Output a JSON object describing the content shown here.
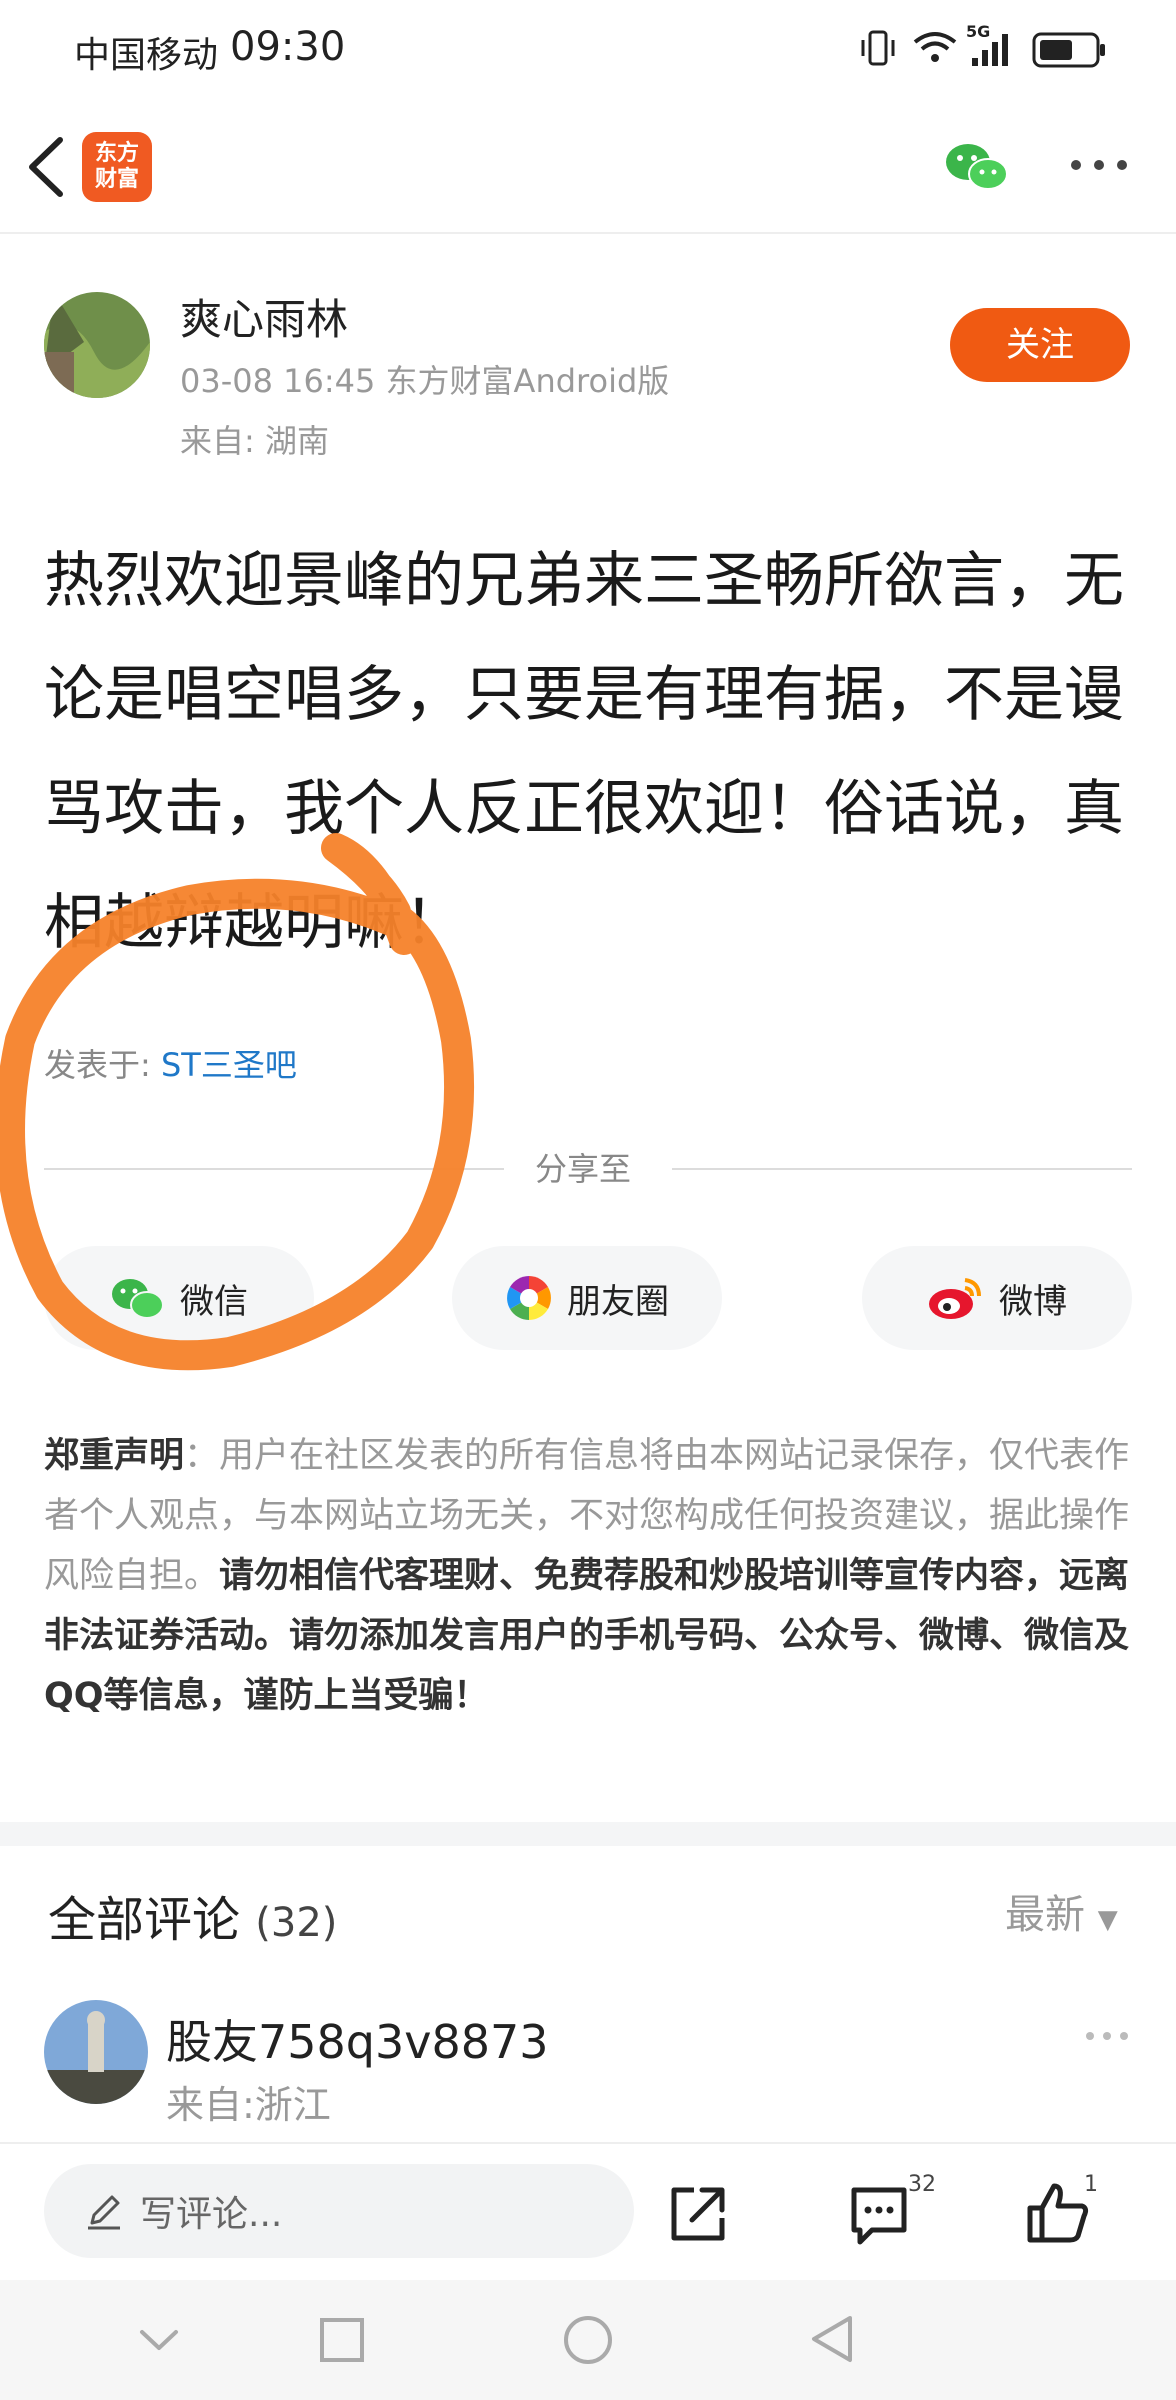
{
  "status_bar": {
    "carrier": "中国移动",
    "time": "09:30",
    "network": "5G"
  },
  "header": {
    "back_icon": "chevron-left-icon",
    "logo_text_line1": "东方",
    "logo_text_line2": "财富",
    "wechat_icon": "wechat-icon",
    "more_icon": "more-horizontal-icon"
  },
  "post": {
    "author": "爽心雨林",
    "meta_time": "03-08 16:45 东方财富Android版",
    "location": "来自: 湖南",
    "follow_label": "关注",
    "content": "热烈欢迎景峰的兄弟来三圣畅所欲言，无论是唱空唱多，只要是有理有据，不是谩骂攻击，我个人反正很欢迎！俗话说，真相越辩越明嘛！",
    "posted_in_label": "发表于: ",
    "posted_in_forum": "ST三圣吧"
  },
  "share": {
    "title": "分享至",
    "buttons": [
      {
        "label": "微信",
        "icon": "wechat-icon"
      },
      {
        "label": "朋友圈",
        "icon": "moments-icon"
      },
      {
        "label": "微博",
        "icon": "weibo-icon"
      }
    ]
  },
  "disclaimer": {
    "heading": "郑重声明",
    "normal": "：用户在社区发表的所有信息将由本网站记录保存，仅代表作者个人观点，与本网站立场无关，不对您构成任何投资建议，据此操作风险自担。",
    "bold": "请勿相信代客理财、免费荐股和炒股培训等宣传内容，远离非法证券活动。请勿添加发言用户的手机号码、公众号、微博、微信及QQ等信息，谨防上当受骗！"
  },
  "comments": {
    "title": "全部评论",
    "count": "(32)",
    "sort_label": "最新",
    "first": {
      "name": "股友758q3v8873",
      "location": "来自:浙江"
    }
  },
  "bottom_bar": {
    "input_placeholder": "写评论...",
    "comment_count": "32",
    "like_count": "1"
  },
  "colors": {
    "accent": "#f05a12",
    "link": "#1f78c8",
    "annotation": "#f5822a"
  }
}
